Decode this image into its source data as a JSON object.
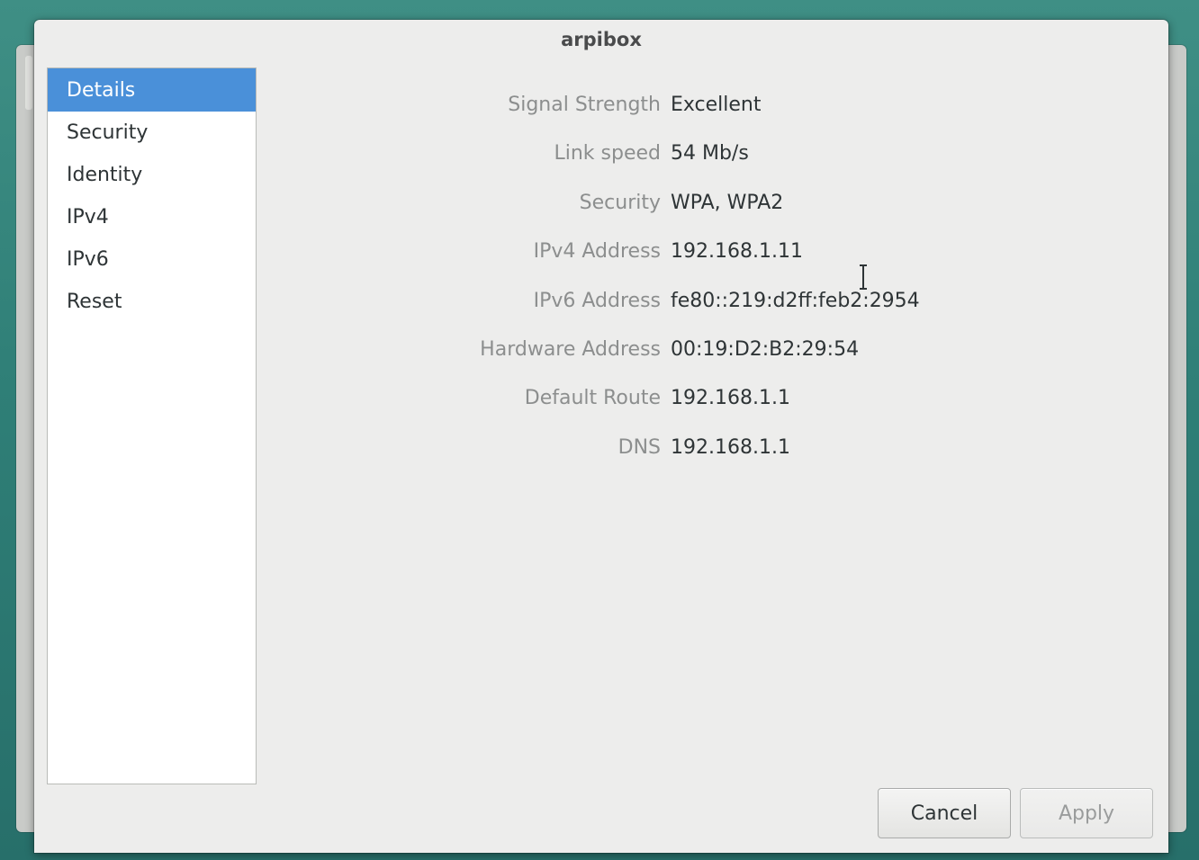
{
  "dialog": {
    "title": "arpibox"
  },
  "sidebar": {
    "items": [
      {
        "label": "Details",
        "selected": true
      },
      {
        "label": "Security",
        "selected": false
      },
      {
        "label": "Identity",
        "selected": false
      },
      {
        "label": "IPv4",
        "selected": false
      },
      {
        "label": "IPv6",
        "selected": false
      },
      {
        "label": "Reset",
        "selected": false
      }
    ]
  },
  "details": {
    "rows": [
      {
        "label": "Signal Strength",
        "value": "Excellent"
      },
      {
        "label": "Link speed",
        "value": "54 Mb/s"
      },
      {
        "label": "Security",
        "value": "WPA, WPA2"
      },
      {
        "label": "IPv4 Address",
        "value": "192.168.1.11"
      },
      {
        "label": "IPv6 Address",
        "value": "fe80::219:d2ff:feb2:2954"
      },
      {
        "label": "Hardware Address",
        "value": "00:19:D2:B2:29:54"
      },
      {
        "label": "Default Route",
        "value": "192.168.1.1"
      },
      {
        "label": "DNS",
        "value": "192.168.1.1"
      }
    ]
  },
  "buttons": {
    "cancel_label": "Cancel",
    "apply_label": "Apply",
    "apply_enabled": false
  },
  "colors": {
    "selection": "#4a90d9",
    "dialog_bg": "#ededec",
    "label_text": "#8c8e8e",
    "value_text": "#2e3436"
  },
  "cursor": {
    "icon": "text-cursor-icon"
  }
}
